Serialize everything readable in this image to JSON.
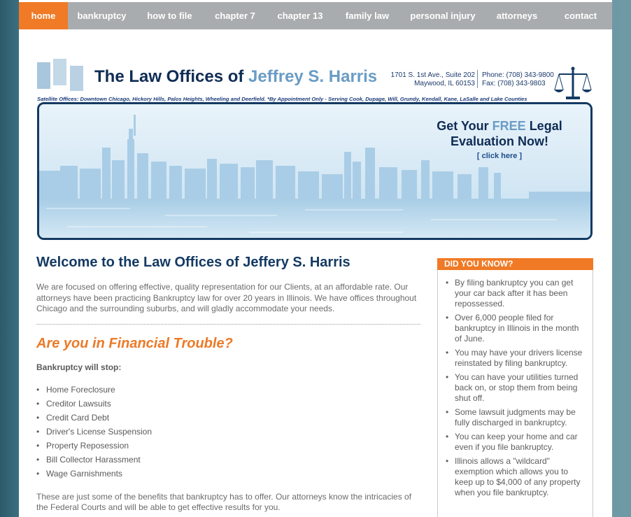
{
  "nav": {
    "items": [
      {
        "label": "home",
        "active": true
      },
      {
        "label": "bankruptcy"
      },
      {
        "label": "how to file"
      },
      {
        "label": "chapter 7"
      },
      {
        "label": "chapter 13"
      },
      {
        "label": "family law"
      },
      {
        "label": "personal injury"
      },
      {
        "label": "attorneys"
      },
      {
        "label": "contact"
      }
    ]
  },
  "header": {
    "title_prefix": "The Law Offices of",
    "title_name": "Jeffrey S. Harris",
    "address_line1": "1701 S. 1st Ave., Suite 202",
    "address_line2": "Maywood, IL 60153",
    "phone": "Phone: (708) 343-9800",
    "fax": "Fax: (708) 343-9803",
    "satellite": "Satellite Offices: Downtown Chicago, Hickory Hills, Palos Heights, Wheeling and Deerfield. *By Appointment Only - Serving Cook, Dupage, Will, Grundy, Kendall, Kane, LaSalle and Lake Counties"
  },
  "hero": {
    "cta_line1_a": "Get Your",
    "cta_line1_free": "FREE",
    "cta_line1_b": "Legal",
    "cta_line2": "Evaluation Now!",
    "click": "[ click here ]"
  },
  "main": {
    "heading": "Welcome to the Law Offices of Jeffery S. Harris",
    "intro": "We are focused on offering effective, quality representation for our Clients, at an affordable rate. Our attorneys have been practicing Bankruptcy law for over 20 years in Illinois. We have offices throughout Chicago and the surrounding suburbs, and will gladly accommodate your needs.",
    "subheading": "Are you in Financial Trouble?",
    "stop_label": "Bankruptcy will stop:",
    "stop_items": [
      "Home Foreclosure",
      "Creditor Lawsuits",
      "Credit Card Debt",
      "Driver's License Suspension",
      "Property Reposession",
      "Bill Collector Harassment",
      "Wage Garnishments"
    ],
    "bottom_text": "These are just some of the benefits that bankruptcy has to offer. Our attorneys know the intricacies of the Federal Courts and will be able to get effective results for you."
  },
  "sidebar": {
    "heading": "DID YOU KNOW?",
    "facts": [
      "By filing bankruptcy you can get your car back after it has been repossessed.",
      "Over 6,000 people filed for bankruptcy in Illinois in the month of June.",
      "You may have your drivers license reinstated by filing bankruptcy.",
      "You can have your utilities turned back on, or stop them from being shut off.",
      "Some lawsuit judgments may be fully discharged in bankruptcy.",
      "You can keep your home and car even if you file bankruptcy.",
      "Illinois allows a \"wildcard\" exemption which allows you to keep up to $4,000 of any property when you file bankruptcy."
    ]
  },
  "colors": {
    "accent_orange": "#f07a25",
    "navy": "#143a63",
    "light_blue": "#6a9cc4",
    "nav_gray": "#a9acae"
  }
}
